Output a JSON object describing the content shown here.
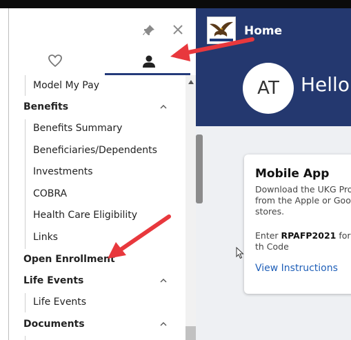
{
  "sidebar": {
    "tabs": [
      {
        "icon": "heart-icon",
        "label": ""
      },
      {
        "icon": "user-icon",
        "label": ""
      }
    ],
    "items": [
      {
        "type": "sub",
        "label": "Model My Pay"
      },
      {
        "type": "section",
        "label": "Benefits",
        "expanded": true
      },
      {
        "type": "sub",
        "label": "Benefits Summary"
      },
      {
        "type": "sub",
        "label": "Beneficiaries/Dependents"
      },
      {
        "type": "sub",
        "label": "Investments"
      },
      {
        "type": "sub",
        "label": "COBRA"
      },
      {
        "type": "sub",
        "label": "Health Care Eligibility"
      },
      {
        "type": "sub",
        "label": "Links"
      },
      {
        "type": "section",
        "label": "Open Enrollment",
        "expanded": false
      },
      {
        "type": "section",
        "label": "Life Events",
        "expanded": true
      },
      {
        "type": "sub",
        "label": "Life Events"
      },
      {
        "type": "section",
        "label": "Documents",
        "expanded": true
      }
    ]
  },
  "header": {
    "title": "Home",
    "avatar_initials": "AT",
    "greeting": "Hello"
  },
  "card": {
    "title": "Mobile App",
    "description": "Download the UKG Pro from the Apple or Goog stores.",
    "code_prefix": "Enter ",
    "code": "RPAFP2021",
    "code_suffix": " for th Code",
    "link": "View Instructions"
  },
  "colors": {
    "brand": "#24386f",
    "link": "#1f5fb8",
    "annotation_arrow": "#e8383d"
  }
}
